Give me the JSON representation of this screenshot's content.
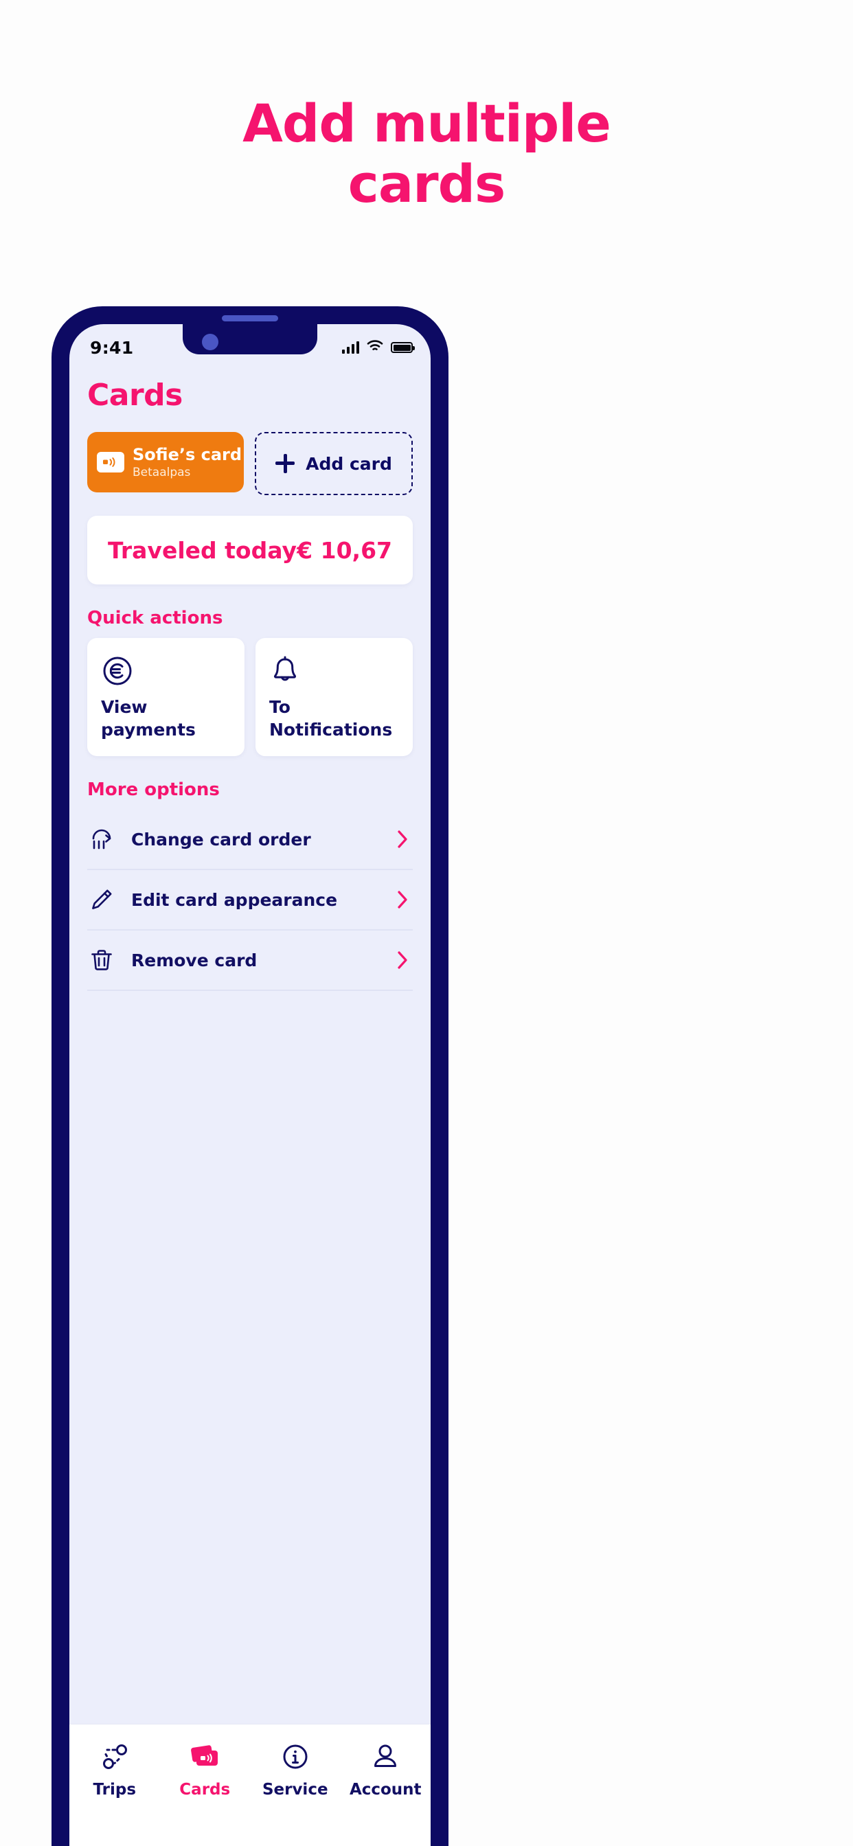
{
  "promo": {
    "line1": "Add multiple",
    "line2": "cards"
  },
  "colors": {
    "pink": "#f5146e",
    "navy": "#0d0a63",
    "orange": "#ef7b10",
    "screen_bg": "#eceefb",
    "card_bg": "#ffffff"
  },
  "phone": {
    "statusbar": {
      "time": "9:41",
      "signal_icon": "cellular-signal-icon",
      "wifi_icon": "wifi-icon",
      "battery_icon": "battery-full-icon"
    }
  },
  "screen": {
    "title": "Cards",
    "my_card": {
      "icon": "contactless-card-icon",
      "name": "Sofie’s card",
      "type": "Betaalpas"
    },
    "add_card": {
      "icon": "plus-icon",
      "label": "Add card"
    },
    "traveled": {
      "label": "Traveled today",
      "amount": "€ 10,67"
    },
    "quick_actions": {
      "heading": "Quick actions",
      "items": [
        {
          "icon": "euro-circle-icon",
          "label": "View payments"
        },
        {
          "icon": "bell-icon",
          "label": "To Notifications"
        }
      ]
    },
    "more_options": {
      "heading": "More options",
      "items": [
        {
          "icon": "reorder-cards-icon",
          "label": "Change card order",
          "chevron": "chevron-right-icon"
        },
        {
          "icon": "pencil-icon",
          "label": "Edit card appearance",
          "chevron": "chevron-right-icon"
        },
        {
          "icon": "trash-icon",
          "label": "Remove card",
          "chevron": "chevron-right-icon"
        }
      ]
    },
    "tabbar": {
      "items": [
        {
          "icon": "trips-route-icon",
          "label": "Trips",
          "active": false
        },
        {
          "icon": "cards-stack-icon",
          "label": "Cards",
          "active": true
        },
        {
          "icon": "info-circle-icon",
          "label": "Service",
          "active": false
        },
        {
          "icon": "person-icon",
          "label": "Account",
          "active": false
        }
      ]
    }
  }
}
